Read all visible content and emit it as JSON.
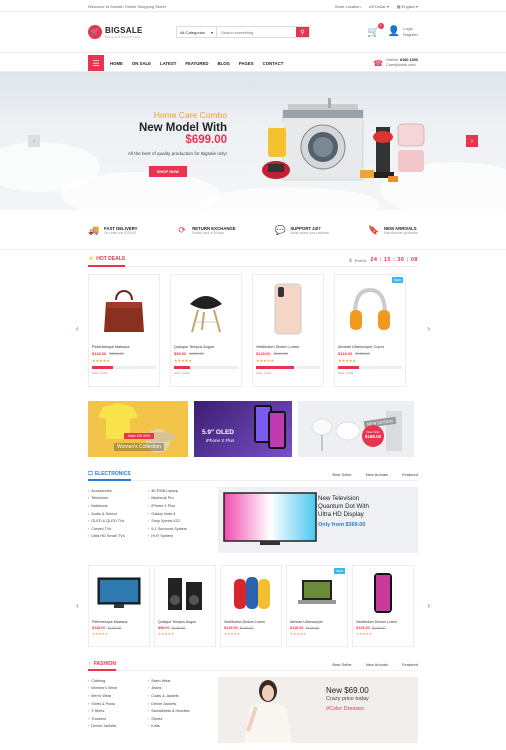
{
  "topbar": {
    "welcome": "Welcome to Smokin Online Shopping Store!",
    "store": "Store Location",
    "currency": "US Dollar",
    "language": "English"
  },
  "header": {
    "brand": "BIGSALE",
    "tagline": "MEGASHOPPING",
    "category": "All Categories",
    "search_placeholder": "Search something",
    "cart_count": "0",
    "login": "Login",
    "register": "Register"
  },
  "nav": {
    "items": [
      "HOME",
      "ON SALE",
      "LATEST",
      "FEATURED",
      "BLOG",
      "PAGES",
      "CONTACT"
    ],
    "hotline_label": "Hotline:",
    "hotline_number": "8180 1000",
    "email": "Care@sohin.com"
  },
  "hero": {
    "subtitle": "Home Care Combo",
    "title_prefix": "New Model With ",
    "price": "$699.00",
    "desc": "All the best of quality production for Bigsale only!",
    "cta": "SHOP NOW"
  },
  "features": [
    {
      "title": "FAST DELIVERY",
      "sub": "On order over $199.00"
    },
    {
      "title": "RETURN EXCHANGE",
      "sub": "Money back in 30days"
    },
    {
      "title": "SUPPORT 24/7",
      "sub": "Alway online ours customer"
    },
    {
      "title": "NEW ARRIVALS",
      "sub": "Manufacturer guarantee"
    }
  ],
  "hotdeals": {
    "title": "HOT DEALS",
    "ends": "End in:",
    "timer": "24 : 15 : 36 : 08",
    "items": [
      {
        "name": "Pellentesque Malesua",
        "price": "$118.00",
        "old": "$126.00",
        "sold": "Sold: 12/36",
        "fill": 0.33
      },
      {
        "name": "Quisque Tempus Augue",
        "price": "$98.00",
        "old": "$120.00",
        "sold": "Sold: 10/40",
        "fill": 0.25
      },
      {
        "name": "Vestibulum Dictum Lorem",
        "price": "$128.00",
        "old": "$140.00",
        "sold": "Sold: 14/23",
        "fill": 0.6
      },
      {
        "name": "Aenean Ullamcorper Copor",
        "price": "$118.00",
        "old": "$126.00",
        "sold": "Sold: 10/30",
        "fill": 0.33
      }
    ],
    "new_badge": "NEW"
  },
  "banners": {
    "b1_tag": "Sale Off 40%",
    "b1_title": "Women's Collection",
    "b2_title": "5.9\" OLED",
    "b2_sub": "iPhone X Plus",
    "b3_tag": "Now Only",
    "b3_price": "$169.00",
    "b3_title": "NEW DESIGN"
  },
  "electronics": {
    "title": "ELECTRONICS",
    "tabs": [
      "Best Seller",
      "New Arrivals",
      "Featured"
    ],
    "col1": [
      "Accessories",
      "Television",
      "Notebook",
      "Audio & Sound",
      "OLED & QLED TVs",
      "Curved TVs",
      "Ultra HD Smart TVs"
    ],
    "col2": [
      "4K RGB Laptop",
      "Macbook Pro",
      "iPhone X Plus",
      "Galaxy Note 8",
      "Sony Xperia XZ2",
      "5.1 Surround System",
      "Hi-Fi System"
    ],
    "banner_l1": "New Television",
    "banner_l2": "Quantum Dot With",
    "banner_l3": "Ultra HD Display",
    "banner_price": "Only from $369.00",
    "products": [
      {
        "name": "Pellentesque Malesua",
        "price": "$118.00",
        "old": "$126.00"
      },
      {
        "name": "Quisque Tempus Augue",
        "price": "$98.00",
        "old": "$120.00"
      },
      {
        "name": "Vestibulum Dictum Lorem",
        "price": "$128.00",
        "old": "$140.00"
      },
      {
        "name": "Aenean Ullamcorper",
        "price": "$118.00",
        "old": "$126.00"
      },
      {
        "name": "Vestibulum Dictum Lorem",
        "price": "$128.00",
        "old": "$140.00"
      }
    ]
  },
  "fashion": {
    "title": "FASHION",
    "tabs": [
      "Best Seller",
      "New Arrivals",
      "Featured"
    ],
    "col1": [
      "Clothing",
      "Women's Wear",
      "Men's Wear",
      "Shirts & Polos",
      "T-Shirts",
      "Trousers",
      "Denim Jackets"
    ],
    "col2": [
      "Swim Wear",
      "Jeans",
      "Coats & Jackets",
      "Denim Jackets",
      "Sweatshirts & Hoodies",
      "Shorts",
      "Knits"
    ],
    "banner_price": "New $69.00",
    "banner_l2": "Crazy price today",
    "banner_tag": "#Color Dresses"
  },
  "colors": {
    "accent": "#e8344e",
    "electronics": "#2a7bd8",
    "gold": "#f0a030"
  }
}
